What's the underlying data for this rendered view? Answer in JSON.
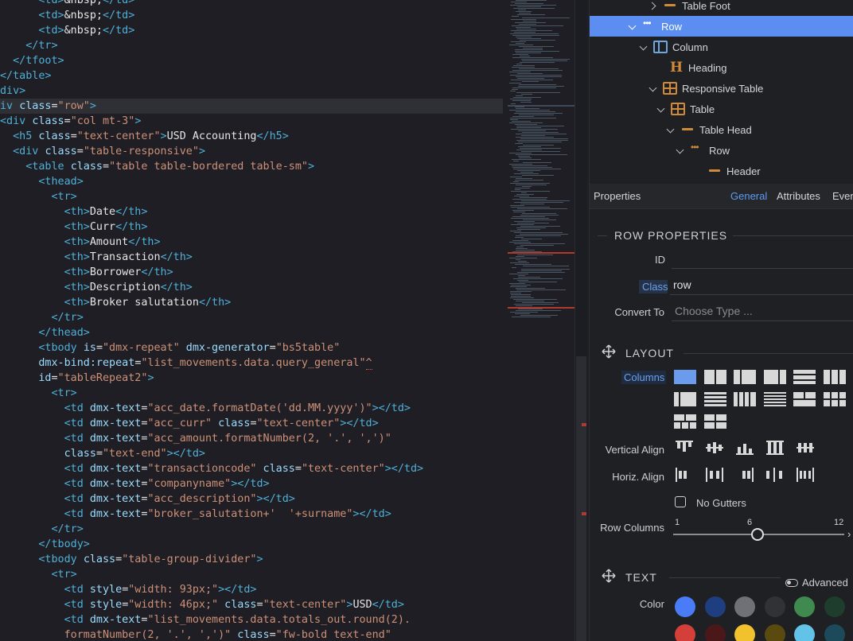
{
  "editor": {
    "lines": [
      [
        {
          "t": "      ",
          "c": ""
        },
        {
          "t": "<td>",
          "c": "tag"
        },
        {
          "t": "&nbsp;",
          "c": "txt"
        },
        {
          "t": "</td>",
          "c": "tag"
        }
      ],
      [
        {
          "t": "      ",
          "c": ""
        },
        {
          "t": "<td>",
          "c": "tag"
        },
        {
          "t": "&nbsp;",
          "c": "txt"
        },
        {
          "t": "</td>",
          "c": "tag"
        }
      ],
      [
        {
          "t": "      ",
          "c": ""
        },
        {
          "t": "<td>",
          "c": "tag"
        },
        {
          "t": "&nbsp;",
          "c": "txt"
        },
        {
          "t": "</td>",
          "c": "tag"
        }
      ],
      [
        {
          "t": "    ",
          "c": ""
        },
        {
          "t": "</tr>",
          "c": "tag"
        }
      ],
      [
        {
          "t": "  ",
          "c": ""
        },
        {
          "t": "</tfoot>",
          "c": "tag"
        }
      ],
      [
        {
          "t": "</table>",
          "c": "tag"
        }
      ],
      [
        {
          "t": "div>",
          "c": "tag"
        }
      ],
      [
        {
          "t": "iv ",
          "c": "tag"
        },
        {
          "t": "class",
          "c": "at"
        },
        {
          "t": "=",
          "c": "txt"
        },
        {
          "t": "\"row\"",
          "c": "str"
        },
        {
          "t": ">",
          "c": "tag"
        }
      ],
      [
        {
          "t": "<div ",
          "c": "tag"
        },
        {
          "t": "class",
          "c": "at"
        },
        {
          "t": "=",
          "c": "txt"
        },
        {
          "t": "\"col mt-3\"",
          "c": "str"
        },
        {
          "t": ">",
          "c": "tag"
        }
      ],
      [
        {
          "t": "  ",
          "c": ""
        },
        {
          "t": "<h5 ",
          "c": "tag"
        },
        {
          "t": "class",
          "c": "at"
        },
        {
          "t": "=",
          "c": "txt"
        },
        {
          "t": "\"text-center\"",
          "c": "str"
        },
        {
          "t": ">",
          "c": "tag"
        },
        {
          "t": "USD Accounting",
          "c": "txt"
        },
        {
          "t": "</h5>",
          "c": "tag"
        }
      ],
      [
        {
          "t": "  ",
          "c": ""
        },
        {
          "t": "<div ",
          "c": "tag"
        },
        {
          "t": "class",
          "c": "at"
        },
        {
          "t": "=",
          "c": "txt"
        },
        {
          "t": "\"table-responsive\"",
          "c": "str"
        },
        {
          "t": ">",
          "c": "tag"
        }
      ],
      [
        {
          "t": "    ",
          "c": ""
        },
        {
          "t": "<table ",
          "c": "tag"
        },
        {
          "t": "class",
          "c": "at"
        },
        {
          "t": "=",
          "c": "txt"
        },
        {
          "t": "\"table table-bordered table-sm\"",
          "c": "str"
        },
        {
          "t": ">",
          "c": "tag"
        }
      ],
      [
        {
          "t": "      ",
          "c": ""
        },
        {
          "t": "<thead>",
          "c": "tag"
        }
      ],
      [
        {
          "t": "        ",
          "c": ""
        },
        {
          "t": "<tr>",
          "c": "tag"
        }
      ],
      [
        {
          "t": "          ",
          "c": ""
        },
        {
          "t": "<th>",
          "c": "tag"
        },
        {
          "t": "Date",
          "c": "txt"
        },
        {
          "t": "</th>",
          "c": "tag"
        }
      ],
      [
        {
          "t": "          ",
          "c": ""
        },
        {
          "t": "<th>",
          "c": "tag"
        },
        {
          "t": "Curr",
          "c": "txt"
        },
        {
          "t": "</th>",
          "c": "tag"
        }
      ],
      [
        {
          "t": "          ",
          "c": ""
        },
        {
          "t": "<th>",
          "c": "tag"
        },
        {
          "t": "Amount",
          "c": "txt"
        },
        {
          "t": "</th>",
          "c": "tag"
        }
      ],
      [
        {
          "t": "          ",
          "c": ""
        },
        {
          "t": "<th>",
          "c": "tag"
        },
        {
          "t": "Transaction",
          "c": "txt"
        },
        {
          "t": "</th>",
          "c": "tag"
        }
      ],
      [
        {
          "t": "          ",
          "c": ""
        },
        {
          "t": "<th>",
          "c": "tag"
        },
        {
          "t": "Borrower",
          "c": "txt"
        },
        {
          "t": "</th>",
          "c": "tag"
        }
      ],
      [
        {
          "t": "          ",
          "c": ""
        },
        {
          "t": "<th>",
          "c": "tag"
        },
        {
          "t": "Description",
          "c": "txt"
        },
        {
          "t": "</th>",
          "c": "tag"
        }
      ],
      [
        {
          "t": "          ",
          "c": ""
        },
        {
          "t": "<th>",
          "c": "tag"
        },
        {
          "t": "Broker salutation",
          "c": "txt"
        },
        {
          "t": "</th>",
          "c": "tag"
        }
      ],
      [
        {
          "t": "        ",
          "c": ""
        },
        {
          "t": "</tr>",
          "c": "tag"
        }
      ],
      [
        {
          "t": "      ",
          "c": ""
        },
        {
          "t": "</thead>",
          "c": "tag"
        }
      ],
      [
        {
          "t": "      ",
          "c": ""
        },
        {
          "t": "<tbody ",
          "c": "tag"
        },
        {
          "t": "is",
          "c": "at"
        },
        {
          "t": "=",
          "c": "txt"
        },
        {
          "t": "\"dmx-repeat\"",
          "c": "str"
        },
        {
          "t": " dmx-generator",
          "c": "at"
        },
        {
          "t": "=",
          "c": "txt"
        },
        {
          "t": "\"bs5table\"",
          "c": "str"
        }
      ],
      [
        {
          "t": "      ",
          "c": ""
        },
        {
          "t": "dmx-bind:repeat",
          "c": "at"
        },
        {
          "t": "=",
          "c": "txt"
        },
        {
          "t": "\"list_movements.data.query_general\"",
          "c": "str"
        },
        {
          "t": "^",
          "c": "str"
        }
      ],
      [
        {
          "t": "      ",
          "c": ""
        },
        {
          "t": "id",
          "c": "at"
        },
        {
          "t": "=",
          "c": "txt"
        },
        {
          "t": "\"tableRepeat2\"",
          "c": "str"
        },
        {
          "t": ">",
          "c": "tag"
        }
      ],
      [
        {
          "t": "        ",
          "c": ""
        },
        {
          "t": "<tr>",
          "c": "tag"
        }
      ],
      [
        {
          "t": "          ",
          "c": ""
        },
        {
          "t": "<td ",
          "c": "tag"
        },
        {
          "t": "dmx-text",
          "c": "at"
        },
        {
          "t": "=",
          "c": "txt"
        },
        {
          "t": "\"acc_date.formatDate('dd.MM.yyyy')\"",
          "c": "str"
        },
        {
          "t": "></td>",
          "c": "tag"
        }
      ],
      [
        {
          "t": "          ",
          "c": ""
        },
        {
          "t": "<td ",
          "c": "tag"
        },
        {
          "t": "dmx-text",
          "c": "at"
        },
        {
          "t": "=",
          "c": "txt"
        },
        {
          "t": "\"acc_curr\"",
          "c": "str"
        },
        {
          "t": " class",
          "c": "at"
        },
        {
          "t": "=",
          "c": "txt"
        },
        {
          "t": "\"text-center\"",
          "c": "str"
        },
        {
          "t": "></td>",
          "c": "tag"
        }
      ],
      [
        {
          "t": "          ",
          "c": ""
        },
        {
          "t": "<td ",
          "c": "tag"
        },
        {
          "t": "dmx-text",
          "c": "at"
        },
        {
          "t": "=",
          "c": "txt"
        },
        {
          "t": "\"acc_amount.formatNumber(2, '.', ',')\"",
          "c": "str"
        }
      ],
      [
        {
          "t": "          ",
          "c": ""
        },
        {
          "t": "class",
          "c": "at"
        },
        {
          "t": "=",
          "c": "txt"
        },
        {
          "t": "\"text-end\"",
          "c": "str"
        },
        {
          "t": "></td>",
          "c": "tag"
        }
      ],
      [
        {
          "t": "          ",
          "c": ""
        },
        {
          "t": "<td ",
          "c": "tag"
        },
        {
          "t": "dmx-text",
          "c": "at"
        },
        {
          "t": "=",
          "c": "txt"
        },
        {
          "t": "\"transactioncode\"",
          "c": "str"
        },
        {
          "t": " class",
          "c": "at"
        },
        {
          "t": "=",
          "c": "txt"
        },
        {
          "t": "\"text-center\"",
          "c": "str"
        },
        {
          "t": "></td>",
          "c": "tag"
        }
      ],
      [
        {
          "t": "          ",
          "c": ""
        },
        {
          "t": "<td ",
          "c": "tag"
        },
        {
          "t": "dmx-text",
          "c": "at"
        },
        {
          "t": "=",
          "c": "txt"
        },
        {
          "t": "\"companyname\"",
          "c": "str"
        },
        {
          "t": "></td>",
          "c": "tag"
        }
      ],
      [
        {
          "t": "          ",
          "c": ""
        },
        {
          "t": "<td ",
          "c": "tag"
        },
        {
          "t": "dmx-text",
          "c": "at"
        },
        {
          "t": "=",
          "c": "txt"
        },
        {
          "t": "\"acc_description\"",
          "c": "str"
        },
        {
          "t": "></td>",
          "c": "tag"
        }
      ],
      [
        {
          "t": "          ",
          "c": ""
        },
        {
          "t": "<td ",
          "c": "tag"
        },
        {
          "t": "dmx-text",
          "c": "at"
        },
        {
          "t": "=",
          "c": "txt"
        },
        {
          "t": "\"broker_salutation+'  '+surname\"",
          "c": "str"
        },
        {
          "t": "></td>",
          "c": "tag"
        }
      ],
      [
        {
          "t": "        ",
          "c": ""
        },
        {
          "t": "</tr>",
          "c": "tag"
        }
      ],
      [
        {
          "t": "      ",
          "c": ""
        },
        {
          "t": "</tbody>",
          "c": "tag"
        }
      ],
      [
        {
          "t": "      ",
          "c": ""
        },
        {
          "t": "<tbody ",
          "c": "tag"
        },
        {
          "t": "class",
          "c": "at"
        },
        {
          "t": "=",
          "c": "txt"
        },
        {
          "t": "\"table-group-divider\"",
          "c": "str"
        },
        {
          "t": ">",
          "c": "tag"
        }
      ],
      [
        {
          "t": "        ",
          "c": ""
        },
        {
          "t": "<tr>",
          "c": "tag"
        }
      ],
      [
        {
          "t": "          ",
          "c": ""
        },
        {
          "t": "<td ",
          "c": "tag"
        },
        {
          "t": "style",
          "c": "at"
        },
        {
          "t": "=",
          "c": "txt"
        },
        {
          "t": "\"width: 93px;\"",
          "c": "str"
        },
        {
          "t": "></td>",
          "c": "tag"
        }
      ],
      [
        {
          "t": "          ",
          "c": ""
        },
        {
          "t": "<td ",
          "c": "tag"
        },
        {
          "t": "style",
          "c": "at"
        },
        {
          "t": "=",
          "c": "txt"
        },
        {
          "t": "\"width: 46px;\"",
          "c": "str"
        },
        {
          "t": " class",
          "c": "at"
        },
        {
          "t": "=",
          "c": "txt"
        },
        {
          "t": "\"text-center\"",
          "c": "str"
        },
        {
          "t": ">",
          "c": "tag"
        },
        {
          "t": "USD",
          "c": "txt"
        },
        {
          "t": "</td>",
          "c": "tag"
        }
      ],
      [
        {
          "t": "          ",
          "c": ""
        },
        {
          "t": "<td ",
          "c": "tag"
        },
        {
          "t": "dmx-text",
          "c": "at"
        },
        {
          "t": "=",
          "c": "txt"
        },
        {
          "t": "\"list_movements.data.totals_out.round(2).",
          "c": "str"
        }
      ],
      [
        {
          "t": "          ",
          "c": ""
        },
        {
          "t": "formatNumber(2, '.', ',')\"",
          "c": "str"
        },
        {
          "t": " class",
          "c": "at"
        },
        {
          "t": "=",
          "c": "txt"
        },
        {
          "t": "\"fw-bold text-end\"",
          "c": "str"
        }
      ]
    ]
  },
  "tree": {
    "items": [
      {
        "label": "Table Foot",
        "icon": "table-foot-icon",
        "chevron": "right"
      },
      {
        "label": "Row",
        "icon": "row-icon",
        "chevron": "down",
        "selected": true
      },
      {
        "label": "Column",
        "icon": "column-icon",
        "chevron": "down"
      },
      {
        "label": "Heading",
        "icon": "heading-icon",
        "chevron": "none"
      },
      {
        "label": "Responsive Table",
        "icon": "responsive-table-icon",
        "chevron": "down"
      },
      {
        "label": "Table",
        "icon": "table-icon",
        "chevron": "down"
      },
      {
        "label": "Table Head",
        "icon": "table-head-icon",
        "chevron": "down"
      },
      {
        "label": "Row",
        "icon": "row-icon",
        "chevron": "down"
      },
      {
        "label": "Header",
        "icon": "header-icon",
        "chevron": "none"
      }
    ]
  },
  "properties": {
    "title": "Properties",
    "tabs": [
      "General",
      "Attributes",
      "Even"
    ],
    "row_section": "ROW PROPERTIES",
    "id_label": "ID",
    "id_value": "",
    "class_label": "Class",
    "class_value": "row",
    "convert_label": "Convert To",
    "convert_placeholder": "Choose Type ...",
    "layout_section": "LAYOUT",
    "columns_label": "Columns",
    "valign_label": "Vertical Align",
    "halign_label": "Horiz. Align",
    "no_gutters_label": "No Gutters",
    "row_columns_label": "Row Columns",
    "slider_min": "1",
    "slider_mid": "6",
    "slider_max": "12",
    "slider_value": 6,
    "text_section": "TEXT",
    "advanced_label": "Advanced",
    "color_label": "Color",
    "colors": [
      "#4a7cf7",
      "#1f3e7f",
      "#6f7177",
      "#303236",
      "#3f8a4f",
      "#1e3d2c",
      "#d43f3a",
      "#4a1818",
      "#f2c12e",
      "#5b4a10",
      "#62c2e8",
      "#1d4a5a"
    ]
  }
}
